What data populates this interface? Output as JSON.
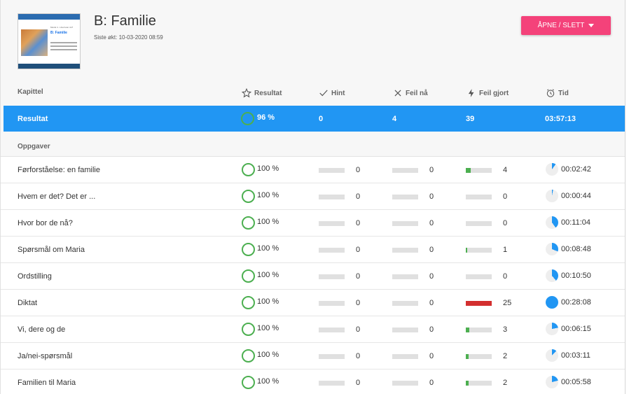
{
  "header": {
    "title": "B: Familie",
    "last_seen": "Siste økt: 10-03-2020 08:59",
    "open_button": "ÅPNE / SLETT",
    "thumb": {
      "module": "Modul 4 - Hva heter du?",
      "title": "B: Familie"
    }
  },
  "columns": {
    "chapter": "Kapittel",
    "result": "Resultat",
    "hint": "Hint",
    "errors_now": "Feil nå",
    "errors_made": "Feil gjort",
    "time": "Tid"
  },
  "summary": {
    "label": "Resultat",
    "result": "96 %",
    "hint": "0",
    "errors_now": "4",
    "errors_made": "39",
    "time": "03:57:13"
  },
  "section_label": "Oppgaver",
  "colors": {
    "accent": "#2196f3",
    "button": "#f4427a",
    "success": "#4caf50",
    "error": "#d32f2f"
  },
  "rows": [
    {
      "name": "Førforståelse: en familie",
      "result": "100 %",
      "hint": "0",
      "errors_now": "0",
      "errors_made": "4",
      "errors_fraction": 0.19,
      "time": "00:02:42",
      "time_fraction": 0.1
    },
    {
      "name": "Hvem er det? Det er ...",
      "result": "100 %",
      "hint": "0",
      "errors_now": "0",
      "errors_made": "0",
      "errors_fraction": 0,
      "time": "00:00:44",
      "time_fraction": 0.03
    },
    {
      "name": "Hvor bor de nå?",
      "result": "100 %",
      "hint": "0",
      "errors_now": "0",
      "errors_made": "0",
      "errors_fraction": 0,
      "time": "00:11:04",
      "time_fraction": 0.4
    },
    {
      "name": "Spørsmål om Maria",
      "result": "100 %",
      "hint": "0",
      "errors_now": "0",
      "errors_made": "1",
      "errors_fraction": 0.05,
      "time": "00:08:48",
      "time_fraction": 0.31
    },
    {
      "name": "Ordstilling",
      "result": "100 %",
      "hint": "0",
      "errors_now": "0",
      "errors_made": "0",
      "errors_fraction": 0,
      "time": "00:10:50",
      "time_fraction": 0.39
    },
    {
      "name": "Diktat",
      "result": "100 %",
      "hint": "0",
      "errors_now": "0",
      "errors_made": "25",
      "errors_fraction": 1,
      "time": "00:28:08",
      "time_fraction": 1
    },
    {
      "name": "Vi, dere og de",
      "result": "100 %",
      "hint": "0",
      "errors_now": "0",
      "errors_made": "3",
      "errors_fraction": 0.14,
      "time": "00:06:15",
      "time_fraction": 0.22
    },
    {
      "name": "Ja/nei-spørsmål",
      "result": "100 %",
      "hint": "0",
      "errors_now": "0",
      "errors_made": "2",
      "errors_fraction": 0.1,
      "time": "00:03:11",
      "time_fraction": 0.12
    },
    {
      "name": "Familien til Maria",
      "result": "100 %",
      "hint": "0",
      "errors_now": "0",
      "errors_made": "2",
      "errors_fraction": 0.1,
      "time": "00:05:58",
      "time_fraction": 0.21
    }
  ]
}
